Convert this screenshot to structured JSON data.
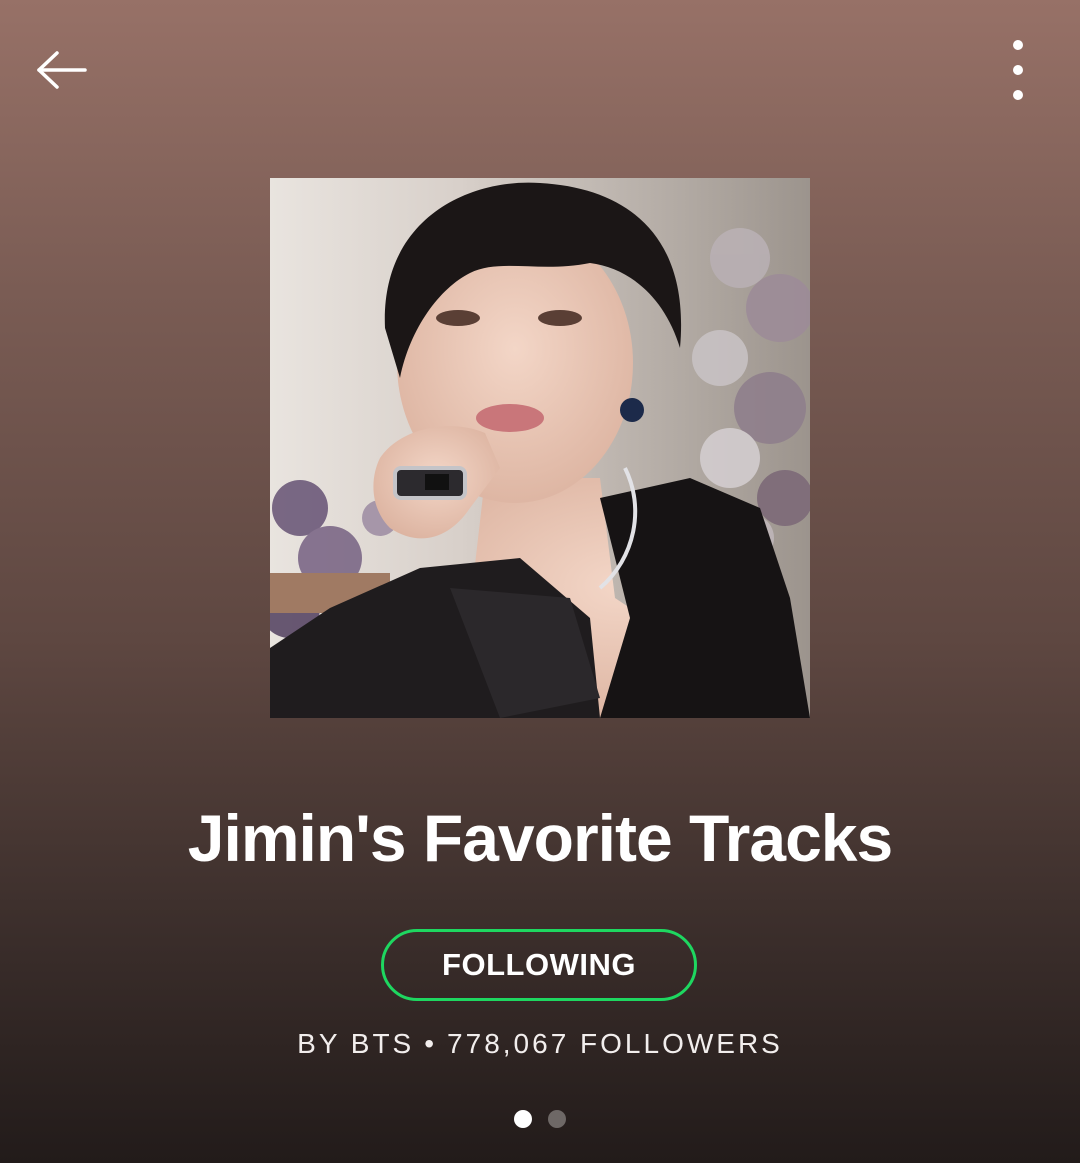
{
  "header": {
    "back_icon": "arrow-left-icon",
    "menu_icon": "more-vertical-icon"
  },
  "playlist": {
    "title": "Jimin's Favorite Tracks",
    "cover_image": "portrait photo of a person with dark hair resting chin on hand, flowers in background",
    "follow_button_label": "FOLLOWING",
    "owner_text": "BY BTS",
    "separator": "•",
    "followers_text": "778,067 FOLLOWERS"
  },
  "pager": {
    "pages": 2,
    "active_index": 0
  },
  "colors": {
    "background_top": "#977167",
    "background_bottom": "#221b1a",
    "follow_border": "#1ed760",
    "text": "#ffffff",
    "pager_inactive": "#6e6866"
  }
}
